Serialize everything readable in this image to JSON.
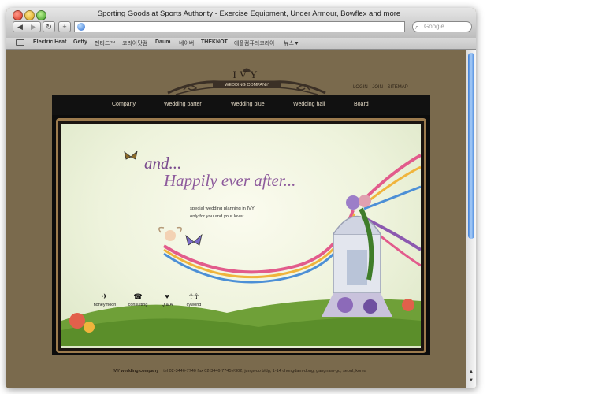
{
  "window": {
    "title": "Sporting Goods at Sports Authority - Exercise Equipment, Under Armour, Bowflex and more"
  },
  "toolbar": {
    "back_label": "◀",
    "forward_label": "▶",
    "reload_label": "↻",
    "add_label": "+",
    "url_value": "",
    "search_placeholder": "Google"
  },
  "bookmarks": [
    "Electric Heat",
    "Getty",
    "펜티드™",
    "코리아닷컴",
    "Daum",
    "네이버",
    "THEKNOT",
    "애플컴퓨터코리아",
    "뉴스▼"
  ],
  "site": {
    "brand": "IVY",
    "brand_sub": "WEDDING COMPANY",
    "top_links": [
      "LOGIN",
      "JOIN",
      "SITEMAP"
    ],
    "nav": [
      "Company",
      "Wedding parter",
      "Wedding plue",
      "Wedding hall",
      "Board"
    ],
    "tagline_1": "and...",
    "tagline_2": "Happily ever after...",
    "desc_1": "special wedding planning in IVY",
    "desc_2": "only for you and your lover",
    "quick_links": [
      {
        "label": "honeymoon",
        "icon": "airplane-icon"
      },
      {
        "label": "consulting",
        "icon": "phone-icon"
      },
      {
        "label": "Q & A",
        "icon": "heart-icon"
      },
      {
        "label": "cyworld",
        "icon": "couple-icon"
      }
    ],
    "footer_name": "IVY  wedding company",
    "footer_info": "tel 02-3446-7740  fax 02-3446-7745  #302, jungwoo bldg, 1-14 chongdam-dong, gangnam-gu, seoul, korea"
  },
  "colors": {
    "page_bg": "#7a6a4d",
    "nav_bg": "#111111",
    "tagline": "#8d5a9c"
  }
}
